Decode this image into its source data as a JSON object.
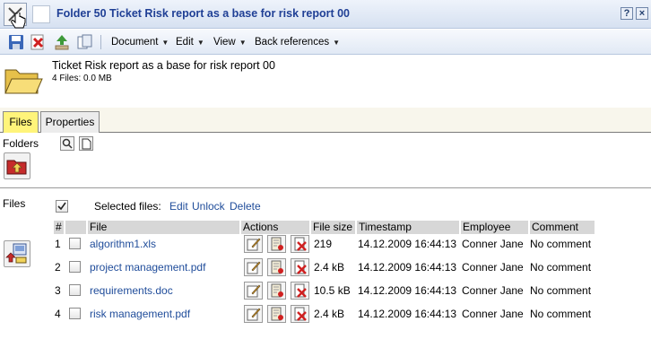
{
  "window": {
    "title": "Folder 50 Ticket Risk report as a base for risk report 00",
    "help_label": "?",
    "close_label": "×"
  },
  "toolbar": {
    "menus": [
      {
        "label": "Document",
        "caret": "▼"
      },
      {
        "label": "Edit",
        "caret": "▼"
      },
      {
        "label": "View",
        "caret": "▼"
      },
      {
        "label": "Back references",
        "caret": "▼"
      }
    ]
  },
  "header": {
    "title": "Ticket Risk report as a base for risk report 00",
    "subtitle": "4 Files: 0.0 MB"
  },
  "tabs": [
    {
      "label": "Files",
      "active": true
    },
    {
      "label": "Properties",
      "active": false
    }
  ],
  "folders": {
    "label": "Folders"
  },
  "files": {
    "label": "Files",
    "selected_label": "Selected files:",
    "actions": [
      {
        "label": "Edit"
      },
      {
        "label": "Unlock"
      },
      {
        "label": "Delete"
      }
    ],
    "columns": [
      "#",
      "File",
      "Actions",
      "File size",
      "Timestamp",
      "Employee",
      "Comment"
    ],
    "rows": [
      {
        "num": "1",
        "file": "algorithm1.xls",
        "size": "219",
        "timestamp": "14.12.2009 16:44:13",
        "employee": "Conner Jane",
        "comment": "No comment"
      },
      {
        "num": "2",
        "file": "project management.pdf",
        "size": "2.4 kB",
        "timestamp": "14.12.2009 16:44:13",
        "employee": "Conner Jane",
        "comment": "No comment"
      },
      {
        "num": "3",
        "file": "requirements.doc",
        "size": "10.5 kB",
        "timestamp": "14.12.2009 16:44:13",
        "employee": "Conner Jane",
        "comment": "No comment"
      },
      {
        "num": "4",
        "file": "risk management.pdf",
        "size": "2.4 kB",
        "timestamp": "14.12.2009 16:44:13",
        "employee": "Conner Jane",
        "comment": "No comment"
      }
    ]
  },
  "colors": {
    "title_text": "#1f3f95",
    "link": "#1f4c9a",
    "active_tab": "#fff47a"
  }
}
